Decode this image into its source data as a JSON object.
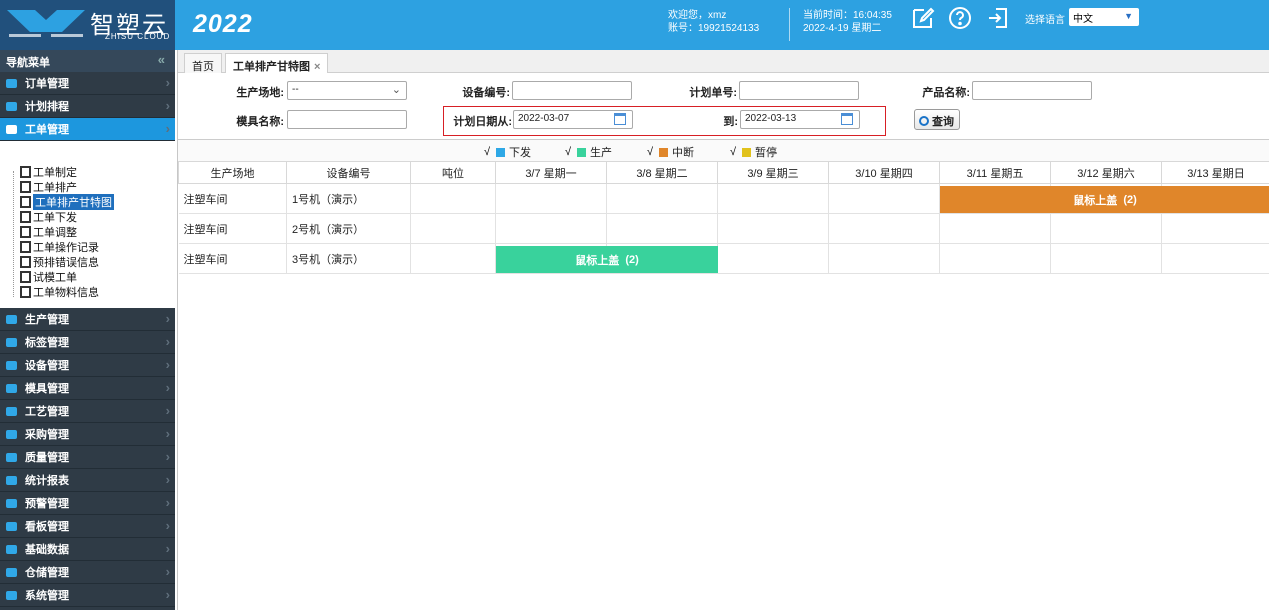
{
  "logo": {
    "cn": "智塑云",
    "en": "ZHISU CLOUD"
  },
  "header": {
    "year": "2022",
    "welcome": "欢迎您，xmz",
    "account": "账号：19921524133",
    "time": "当前时间：16:04:35",
    "date": "2022-4-19 星期二",
    "lang_label": "选择语言",
    "lang_value": "中文"
  },
  "sidebar": {
    "title": "导航菜单",
    "menus_top": [
      {
        "label": "订单管理"
      },
      {
        "label": "计划排程"
      },
      {
        "label": "工单管理"
      }
    ],
    "submenu": [
      {
        "label": "工单制定"
      },
      {
        "label": "工单排产"
      },
      {
        "label": "工单排产甘特图"
      },
      {
        "label": "工单下发"
      },
      {
        "label": "工单调整"
      },
      {
        "label": "工单操作记录"
      },
      {
        "label": "预排错误信息"
      },
      {
        "label": "试模工单"
      },
      {
        "label": "工单物料信息"
      }
    ],
    "menus_bottom": [
      {
        "label": "生产管理"
      },
      {
        "label": "标签管理"
      },
      {
        "label": "设备管理"
      },
      {
        "label": "模具管理"
      },
      {
        "label": "工艺管理"
      },
      {
        "label": "采购管理"
      },
      {
        "label": "质量管理"
      },
      {
        "label": "统计报表"
      },
      {
        "label": "预警管理"
      },
      {
        "label": "看板管理"
      },
      {
        "label": "基础数据"
      },
      {
        "label": "仓储管理"
      },
      {
        "label": "系统管理"
      }
    ]
  },
  "tabs": [
    {
      "label": "首页"
    },
    {
      "label": "工单排产甘特图",
      "close": "×"
    }
  ],
  "filters": {
    "site_label": "生产场地:",
    "site_value": "--",
    "device_label": "设备编号:",
    "device_value": "",
    "plan_no_label": "计划单号:",
    "plan_no_value": "",
    "product_label": "产品名称:",
    "product_value": "",
    "mold_label": "模具名称:",
    "mold_value": "",
    "date_from_label": "计划日期从:",
    "date_from_value": "2022-03-07",
    "date_to_label": "到:",
    "date_to_value": "2022-03-13",
    "query_button": "查询"
  },
  "legend": [
    {
      "check": "√",
      "label": "下发",
      "color": "#2ea8e6"
    },
    {
      "check": "√",
      "label": "生产",
      "color": "#39d29c"
    },
    {
      "check": "√",
      "label": "中断",
      "color": "#e0862a"
    },
    {
      "check": "√",
      "label": "暂停",
      "color": "#e1c21c"
    }
  ],
  "gantt": {
    "columns": [
      "生产场地",
      "设备编号",
      "吨位",
      "3/7 星期一",
      "3/8 星期二",
      "3/9 星期三",
      "3/10 星期四",
      "3/11 星期五",
      "3/12 星期六",
      "3/13 星期日"
    ],
    "rows": [
      {
        "site": "注塑车间",
        "device": "1号机（演示）",
        "tonnage": ""
      },
      {
        "site": "注塑车间",
        "device": "2号机（演示）",
        "tonnage": ""
      },
      {
        "site": "注塑车间",
        "device": "3号机（演示）",
        "tonnage": ""
      }
    ],
    "bars": [
      {
        "row": 0,
        "start": "3/11 星期五",
        "end": "3/13 星期日",
        "label": "鼠标上盖",
        "count": "(2)",
        "status": "中断",
        "color": "#e0862a"
      },
      {
        "row": 2,
        "start": "3/7 星期一",
        "end": "3/8 星期二",
        "label": "鼠标上盖",
        "count": "(2)",
        "status": "生产",
        "color": "#39d29c"
      }
    ]
  }
}
